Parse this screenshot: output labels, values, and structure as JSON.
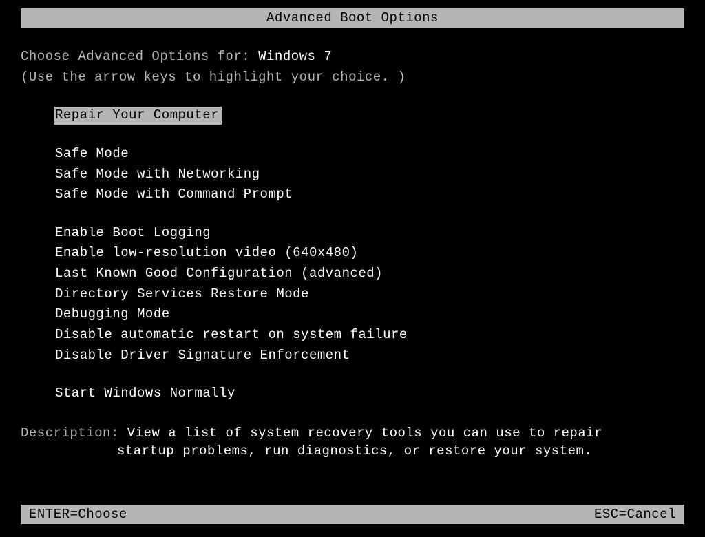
{
  "title": "Advanced Boot Options",
  "header": {
    "prompt_prefix": "Choose Advanced Options for: ",
    "os_name": "Windows 7",
    "instruction": "(Use the arrow keys to highlight your choice. )"
  },
  "menu": {
    "selected_index": 0,
    "groups": [
      [
        "Repair Your Computer"
      ],
      [
        "Safe Mode",
        "Safe Mode with Networking",
        "Safe Mode with Command Prompt"
      ],
      [
        "Enable Boot Logging",
        "Enable low-resolution video (640x480)",
        "Last Known Good Configuration (advanced)",
        "Directory Services Restore Mode",
        "Debugging Mode",
        "Disable automatic restart on system failure",
        "Disable Driver Signature Enforcement"
      ],
      [
        "Start Windows Normally"
      ]
    ]
  },
  "description": {
    "label": "Description: ",
    "line1": "View a list of system recovery tools you can use to repair",
    "line2": "startup problems, run diagnostics, or restore your system."
  },
  "footer": {
    "enter": "ENTER=Choose",
    "esc": "ESC=Cancel"
  }
}
